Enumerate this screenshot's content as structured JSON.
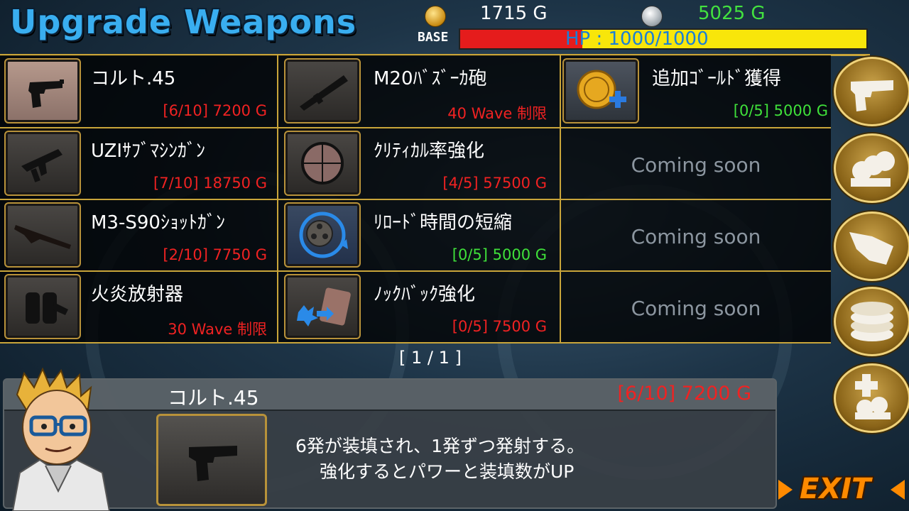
{
  "header": {
    "title": "Upgrade Weapons",
    "gold_icon": "gold-coin-icon",
    "gold": "1715 G",
    "silver_icon": "silver-coin-icon",
    "silver": "5025 G",
    "base_label": "BASE",
    "hp_text": "HP : 1000/1000",
    "hp_fraction": 0.3
  },
  "grid": {
    "cells": [
      {
        "name": "コルト.45",
        "price": "[6/10] 7200 G",
        "price_color": "red",
        "icon": "pistol-icon",
        "selected": true
      },
      {
        "name": "M20ﾊﾞｽﾞｰｶ砲",
        "price": "40 Wave 制限",
        "price_color": "red",
        "icon": "bazooka-icon"
      },
      {
        "name": "追加ｺﾞｰﾙﾄﾞ獲得",
        "price": "[0/5] 5000 G",
        "price_color": "green",
        "icon": "gold-plus-icon"
      },
      {
        "name": "UZIｻﾌﾞﾏｼﾝｶﾞﾝ",
        "price": "[7/10] 18750 G",
        "price_color": "red",
        "icon": "uzi-icon"
      },
      {
        "name": "ｸﾘﾃｨｶﾙ率強化",
        "price": "[4/5] 57500 G",
        "price_color": "red",
        "icon": "crosshair-icon"
      },
      {
        "coming_soon": "Coming soon"
      },
      {
        "name": "M3-S90ｼｮｯﾄｶﾞﾝ",
        "price": "[2/10] 7750 G",
        "price_color": "red",
        "icon": "shotgun-icon"
      },
      {
        "name": "ﾘﾛｰﾄﾞ時間の短縮",
        "price": "[0/5] 5000 G",
        "price_color": "green",
        "icon": "reload-cylinder-icon"
      },
      {
        "coming_soon": "Coming soon"
      },
      {
        "name": "火炎放射器",
        "price": "30 Wave 制限",
        "price_color": "red",
        "icon": "flamethrower-icon"
      },
      {
        "name": "ﾉｯｸﾊﾞｯｸ強化",
        "price": "[0/5] 7500 G",
        "price_color": "red",
        "icon": "knockback-icon"
      },
      {
        "coming_soon": "Coming soon"
      }
    ],
    "pager": "[ 1 / 1 ]"
  },
  "side_tabs": [
    "weapons-tab-pistol-icon",
    "soldiers-tab-icon",
    "defense-tab-icon",
    "gold-coins-tab-icon",
    "heal-tab-icon"
  ],
  "detail": {
    "name": "コルト.45",
    "price": "[6/10] 7200 G",
    "desc_line1": "6発が装填され、1発ずつ発射する。",
    "desc_line2": "強化するとパワーと装填数がUP"
  },
  "exit_label": "EXIT",
  "colors": {
    "accent_gold": "#c9a53a",
    "price_red": "#f02222",
    "price_green": "#3fe03a",
    "title_blue": "#39aef0"
  }
}
